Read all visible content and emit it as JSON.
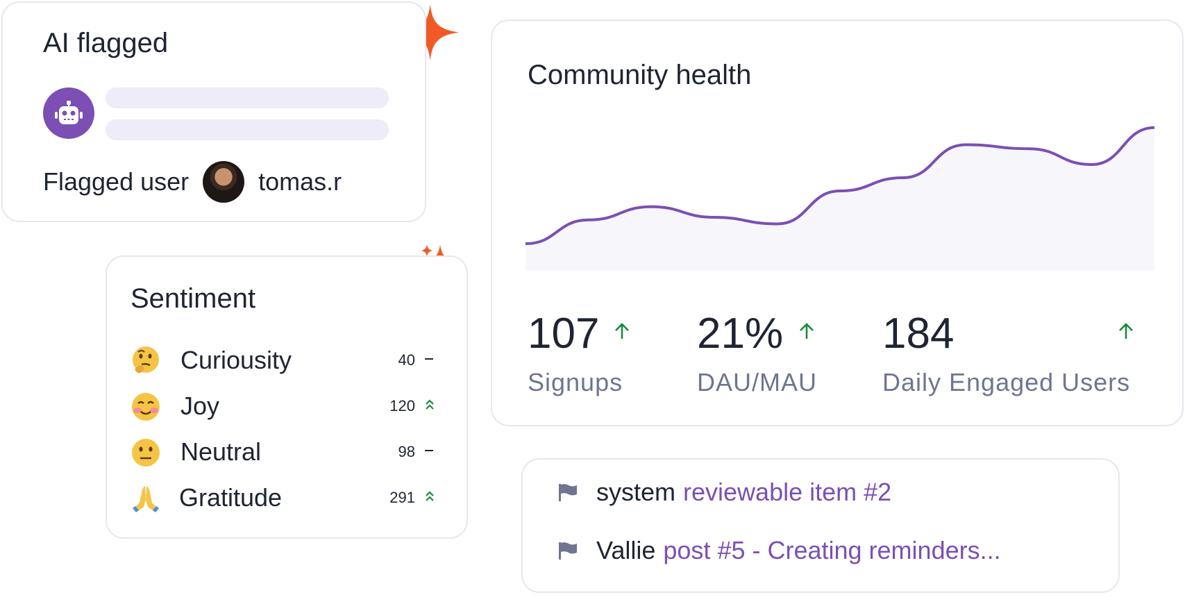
{
  "ai_flagged": {
    "title": "AI flagged",
    "flagged_user_label": "Flagged user",
    "username": "tomas.r"
  },
  "sentiment": {
    "title": "Sentiment",
    "items": [
      {
        "label": "Curiousity",
        "value": "40",
        "trend": "flat",
        "emoji": "thinking-face"
      },
      {
        "label": "Joy",
        "value": "120",
        "trend": "up",
        "emoji": "smiling-face"
      },
      {
        "label": "Neutral",
        "value": "98",
        "trend": "flat",
        "emoji": "neutral-face"
      },
      {
        "label": "Gratitude",
        "value": "291",
        "trend": "up",
        "emoji": "folded-hands"
      }
    ]
  },
  "community_health": {
    "title": "Community health",
    "stats": [
      {
        "value": "107",
        "label": "Signups",
        "trend": "up"
      },
      {
        "value": "21%",
        "label": "DAU/MAU",
        "trend": "up"
      },
      {
        "value": "184",
        "label": "Daily Engaged Users",
        "trend": "up"
      }
    ]
  },
  "chart_data": {
    "type": "line",
    "title": "Community health",
    "xlabel": "",
    "ylabel": "",
    "x": [
      0,
      1,
      2,
      3,
      4,
      5,
      6,
      7,
      8,
      9,
      10
    ],
    "series": [
      {
        "values": [
          10,
          28,
          38,
          30,
          25,
          50,
          60,
          85,
          82,
          70,
          98
        ]
      }
    ],
    "ylim": [
      0,
      100
    ],
    "grid": false
  },
  "review_queue": {
    "items": [
      {
        "user": "system",
        "link": "reviewable item #2"
      },
      {
        "user": "Vallie",
        "link": "post #5 - Creating reminders..."
      }
    ]
  },
  "colors": {
    "accent": "#7b4fb3",
    "sparkle": "#f15a24",
    "up": "#1a8a3a",
    "muted": "#6e7590"
  }
}
